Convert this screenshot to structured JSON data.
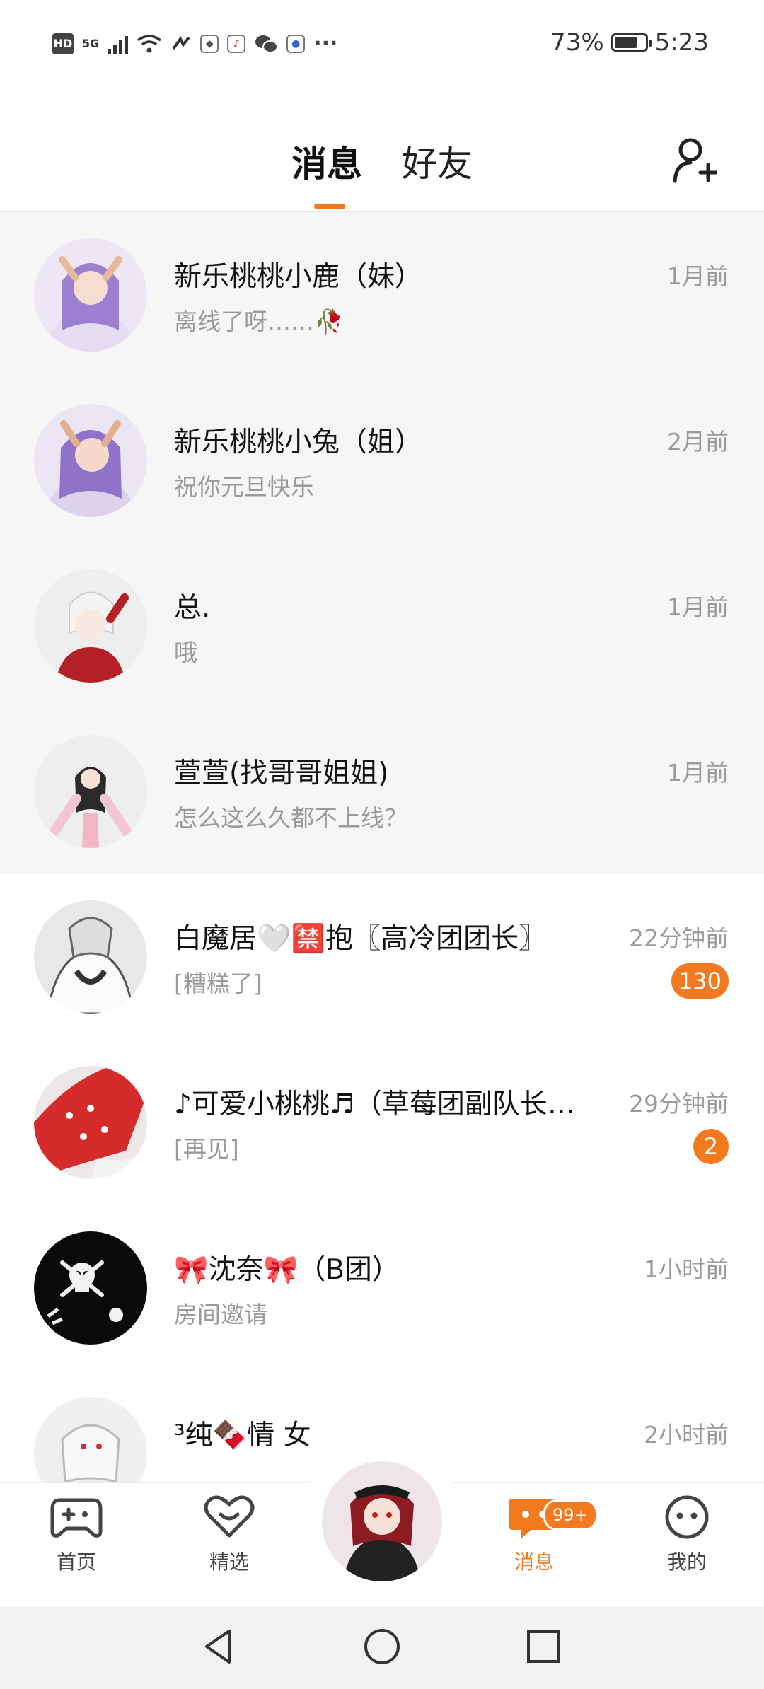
{
  "status_bar": {
    "hd": "HD",
    "net": "5G",
    "battery": "73%",
    "battery_level": 0.73,
    "time": "5:23"
  },
  "header": {
    "tab_messages": "消息",
    "tab_friends": "好友",
    "add_friend_icon": "add-person-icon"
  },
  "conversations": [
    {
      "name": "新乐桃桃小鹿（妹）",
      "message": "离线了呀……🥀",
      "time": "1月前",
      "pinned": true
    },
    {
      "name": "新乐桃桃小兔（姐）",
      "message": "祝你元旦快乐",
      "time": "2月前",
      "pinned": true
    },
    {
      "name": "总.",
      "message": "哦",
      "time": "1月前",
      "pinned": true
    },
    {
      "name": "萱萱(找哥哥姐姐)",
      "message": "怎么这么久都不上线？",
      "time": "1月前",
      "pinned": true
    },
    {
      "name": "白魔居🤍🈲抱〖高冷团团长〗",
      "message": "[糟糕了]",
      "time": "22分钟前",
      "unread": "130"
    },
    {
      "name": "♪可爱小桃桃♬（草莓团副队长…",
      "message": "[再见]",
      "time": "29分钟前",
      "unread": "2"
    },
    {
      "name": "🎀沈奈🎀（B团）",
      "message": "房间邀请",
      "time": "1小时前"
    },
    {
      "name": "³纯🍫情 女",
      "message": "",
      "time": "2小时前"
    }
  ],
  "bottom_nav": {
    "home": "首页",
    "featured": "精选",
    "messages": "消息",
    "messages_badge": "99+",
    "mine": "我的"
  },
  "colors": {
    "accent": "#f47a20",
    "pinned_bg": "#f6f6f6"
  }
}
